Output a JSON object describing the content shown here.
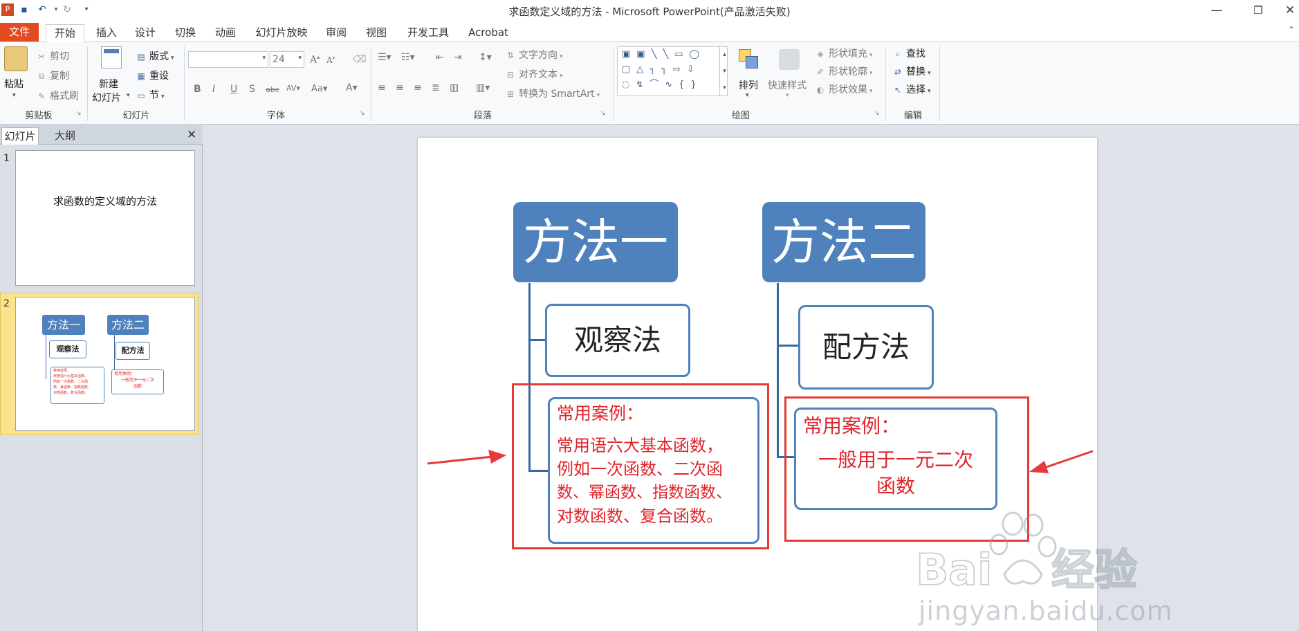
{
  "window": {
    "title": "求函数定义域的方法 - Microsoft PowerPoint(产品激活失败)"
  },
  "menu_tabs": [
    "文件",
    "开始",
    "插入",
    "设计",
    "切换",
    "动画",
    "幻灯片放映",
    "审阅",
    "视图",
    "开发工具",
    "Acrobat"
  ],
  "ribbon": {
    "clipboard": {
      "paste": "粘贴",
      "cut": "剪切",
      "copy": "复制",
      "format_painter": "格式刷",
      "label": "剪贴板"
    },
    "slides": {
      "new_slide_1": "新建",
      "new_slide_2": "幻灯片",
      "layout": "版式",
      "reset": "重设",
      "section": "节",
      "label": "幻灯片"
    },
    "font": {
      "font_name": "",
      "font_size": "24",
      "label": "字体"
    },
    "paragraph": {
      "text_direction": "文字方向",
      "align_text": "对齐文本",
      "convert_smartart": "转换为 SmartArt",
      "label": "段落"
    },
    "drawing": {
      "arrange": "排列",
      "quick_styles": "快速样式",
      "shape_fill": "形状填充",
      "shape_outline": "形状轮廓",
      "shape_effects": "形状效果",
      "label": "绘图"
    },
    "editing": {
      "find": "查找",
      "replace": "替换",
      "select": "选择",
      "label": "编辑"
    }
  },
  "slides_pane": {
    "tabs": [
      "幻灯片",
      "大纲"
    ],
    "slide1": {
      "number": "1",
      "title": "求函数的定义域的方法"
    },
    "slide2": {
      "number": "2"
    }
  },
  "slide": {
    "method1": {
      "title": "方法一",
      "sub": "观察法",
      "case_heading": "常用案例：",
      "case_lines": [
        "常用语六大基本函数，",
        "例如一次函数、二次函",
        "数、幂函数、指数函数、",
        "对数函数、复合函数。"
      ]
    },
    "method2": {
      "title": "方法二",
      "sub": "配方法",
      "case_heading": "常用案例：",
      "case_lines": [
        "一般用于一元二次",
        "函数"
      ]
    }
  },
  "watermark": {
    "text": "jingyan.baidu.com"
  },
  "colors": {
    "accent_blue": "#4f81bd",
    "file_tab": "#e34a1f",
    "annotation_red": "#e63a3a",
    "case_text_red": "#e0242b"
  }
}
